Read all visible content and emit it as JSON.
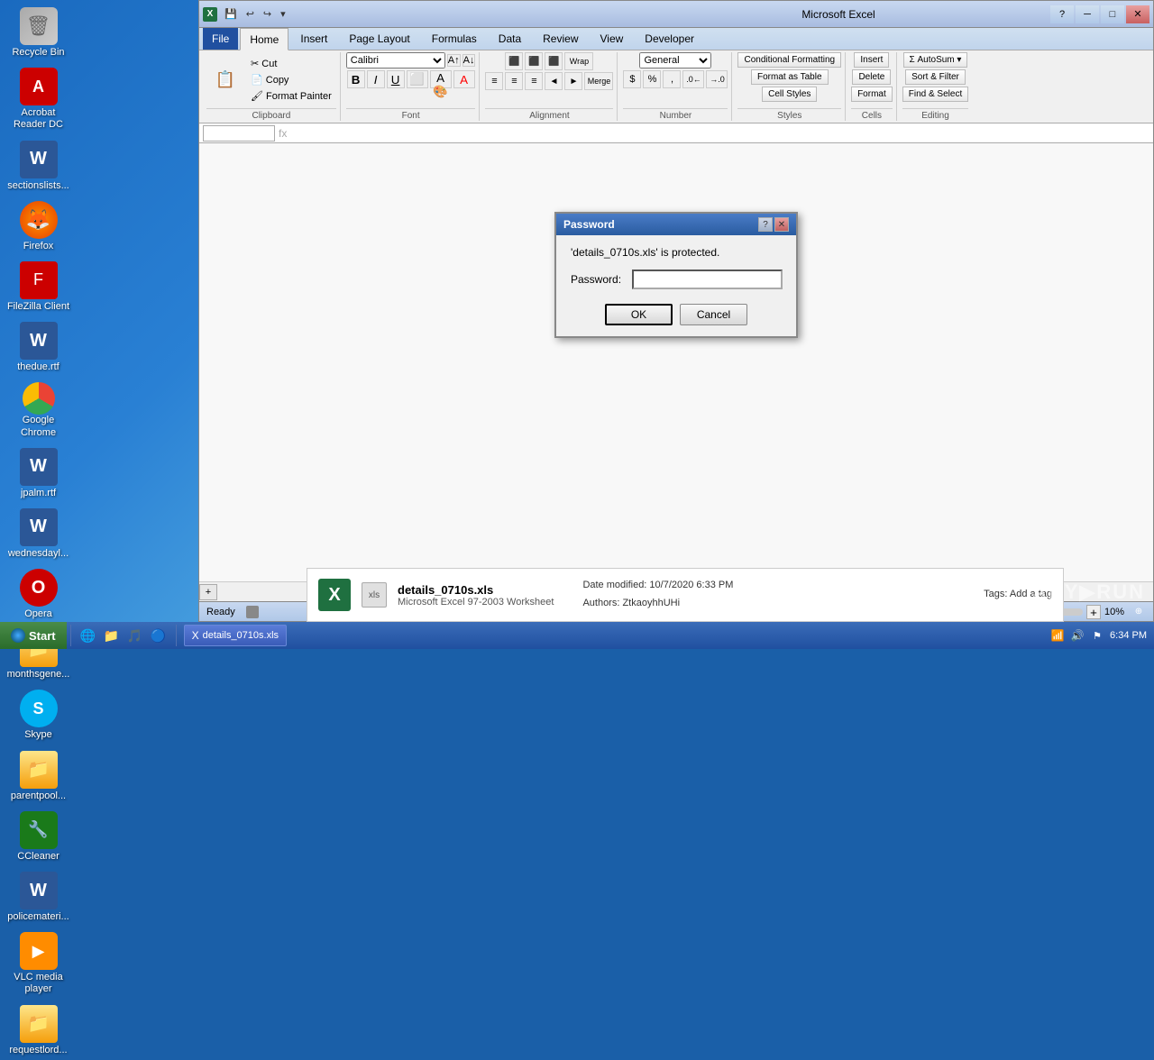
{
  "desktop": {
    "icons": [
      {
        "id": "recycle-bin",
        "label": "Recycle Bin",
        "icon": "🗑",
        "type": "recycle"
      },
      {
        "id": "acrobat",
        "label": "Acrobat Reader DC",
        "icon": "A",
        "type": "acrobat"
      },
      {
        "id": "sectionslists",
        "label": "sectionslists...",
        "icon": "W",
        "type": "word"
      },
      {
        "id": "firefox",
        "label": "Firefox",
        "icon": "🦊",
        "type": "firefox"
      },
      {
        "id": "filezilla",
        "label": "FileZilla Client",
        "icon": "F",
        "type": "filezilla"
      },
      {
        "id": "thedue",
        "label": "thedue.rtf",
        "icon": "W",
        "type": "word"
      },
      {
        "id": "chrome",
        "label": "Google Chrome",
        "icon": "",
        "type": "chrome"
      },
      {
        "id": "jpalm",
        "label": "jpalm.rtf",
        "icon": "W",
        "type": "word"
      },
      {
        "id": "wednesdayl",
        "label": "wednesdayl...",
        "icon": "W",
        "type": "word"
      },
      {
        "id": "opera",
        "label": "Opera",
        "icon": "O",
        "type": "opera"
      },
      {
        "id": "monthsgene",
        "label": "monthsgene...",
        "icon": "📁",
        "type": "folder"
      },
      {
        "id": "skype",
        "label": "Skype",
        "icon": "S",
        "type": "skype"
      },
      {
        "id": "parentpool",
        "label": "parentpool...",
        "icon": "📁",
        "type": "folder"
      },
      {
        "id": "ccleaner",
        "label": "CCleaner",
        "icon": "🔧",
        "type": "ccleaner"
      },
      {
        "id": "policemateri",
        "label": "policemateri...",
        "icon": "W",
        "type": "word"
      },
      {
        "id": "vlc",
        "label": "VLC media player",
        "icon": "▶",
        "type": "vlc"
      },
      {
        "id": "requestlord",
        "label": "requestlord...",
        "icon": "📁",
        "type": "folder"
      }
    ]
  },
  "excel": {
    "title": "Microsoft Excel",
    "tabs": [
      "File",
      "Home",
      "Insert",
      "Page Layout",
      "Formulas",
      "Data",
      "Review",
      "View",
      "Developer"
    ],
    "active_tab": "Home",
    "groups": {
      "clipboard": "Clipboard",
      "font": "Font",
      "alignment": "Alignment",
      "number": "Number",
      "styles": "Styles",
      "cells": "Cells",
      "editing": "Editing"
    },
    "buttons": {
      "paste": "Paste",
      "conditional_formatting": "Conditional Formatting",
      "format_as_table": "Format as Table",
      "cell_styles": "Cell Styles",
      "insert": "Insert",
      "delete": "Delete",
      "format": "Format",
      "sort_filter": "Sort & Filter",
      "find_select": "Find & Select"
    },
    "status": {
      "ready": "Ready",
      "zoom": "10%"
    }
  },
  "dialog": {
    "title": "Password",
    "message": "'details_0710s.xls' is protected.",
    "password_label": "Password:",
    "ok_label": "OK",
    "cancel_label": "Cancel"
  },
  "file_info": {
    "name": "details_0710s.xls",
    "type": "Microsoft Excel 97-2003 Worksheet",
    "date_modified": "Date modified: 10/7/2020 6:33 PM",
    "tags": "Tags: Add a tag",
    "authors": "Authors: ZtkaoyhhUHi"
  },
  "taskbar": {
    "start_label": "Start",
    "items": [
      {
        "label": "details_0710s.xls",
        "icon": "X"
      }
    ],
    "clock": "6:34 PM"
  },
  "anyrun": "ANY▶RUN"
}
